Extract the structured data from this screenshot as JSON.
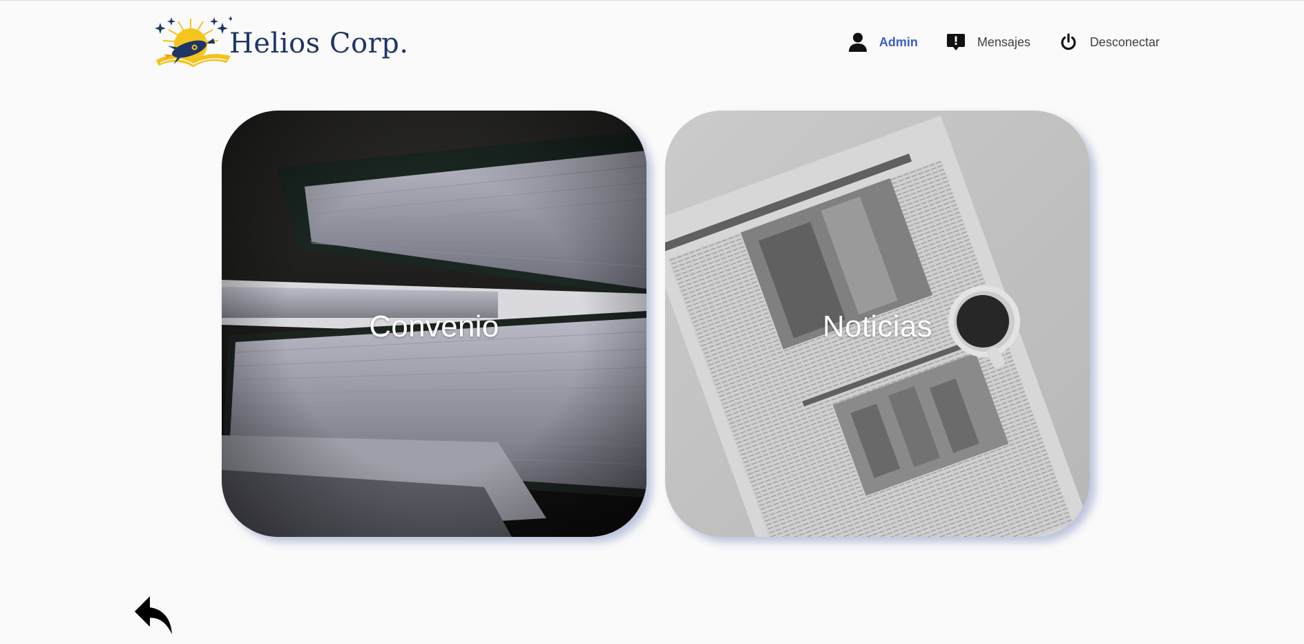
{
  "brand": {
    "name": "Helios Corp.",
    "logo_icon": "rocket-sun-logo"
  },
  "nav": {
    "items": [
      {
        "label": "Admin",
        "icon": "user-icon",
        "active": true
      },
      {
        "label": "Mensajes",
        "icon": "message-alert-icon",
        "active": false
      },
      {
        "label": "Desconectar",
        "icon": "power-icon",
        "active": false
      }
    ]
  },
  "cards": [
    {
      "label": "Convenio",
      "image": "stacked-binders-photo"
    },
    {
      "label": "Noticias",
      "image": "newspaper-coffee-photo"
    }
  ],
  "back": {
    "icon": "reply-arrow-icon"
  },
  "colors": {
    "background": "#fafafa",
    "brand_text": "#1f3566",
    "active_nav": "#3a5cc4",
    "nav_text": "#3f3f3f",
    "card_shadow": "#3c55a0"
  }
}
